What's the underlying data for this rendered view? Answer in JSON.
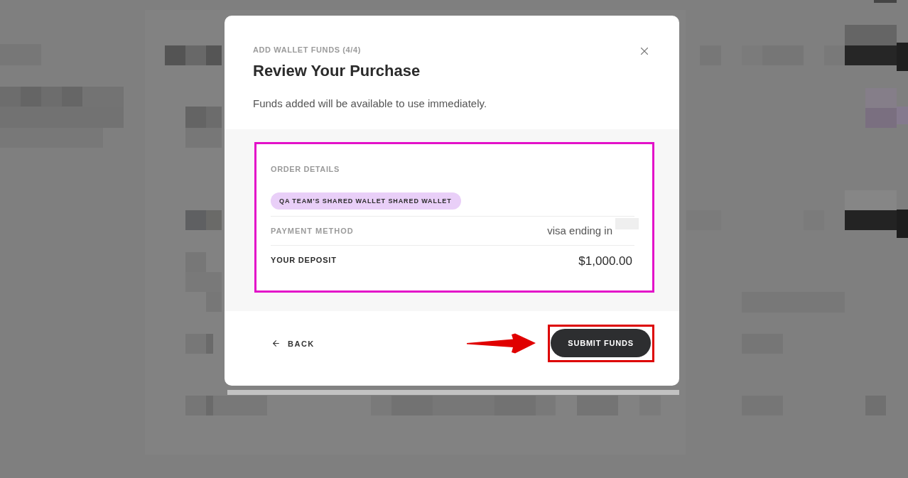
{
  "dialog": {
    "step_label": "ADD WALLET FUNDS (4/4)",
    "title": "Review Your Purchase",
    "subtitle": "Funds added will be available to use immediately.",
    "order_details": {
      "heading": "ORDER DETAILS",
      "highlighted": true,
      "wallet_tag": "QA TEAM'S SHARED WALLET SHARED WALLET",
      "rows": [
        {
          "kind": "payment",
          "label": "PAYMENT METHOD",
          "value": "visa ending in",
          "redacted": true
        },
        {
          "kind": "total",
          "label": "YOUR DEPOSIT",
          "value": "$1,000.00"
        }
      ]
    },
    "footer": {
      "back_button": "BACK",
      "submit_button": {
        "label": "SUBMIT FUNDS",
        "highlighted": true,
        "pointed_at": true
      }
    }
  }
}
